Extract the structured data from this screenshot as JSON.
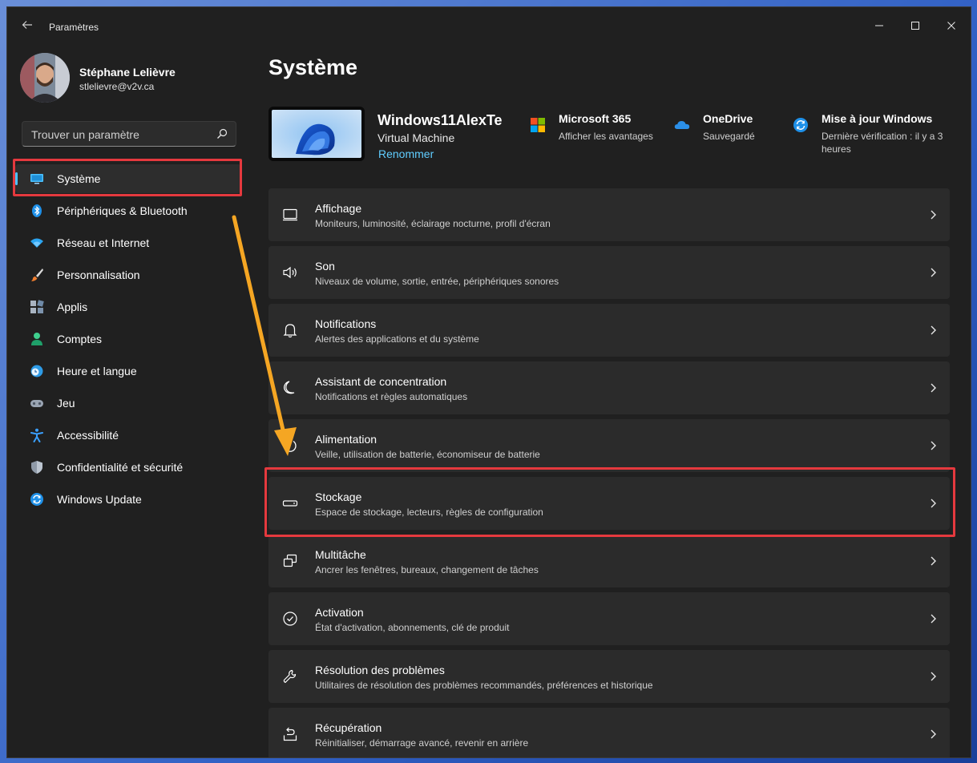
{
  "window": {
    "title": "Paramètres"
  },
  "profile": {
    "name": "Stéphane Lelièvre",
    "email": "stlelievre@v2v.ca"
  },
  "search": {
    "placeholder": "Trouver un paramètre"
  },
  "sidebar": {
    "items": [
      {
        "label": "Système",
        "icon": "monitor-icon",
        "active": true
      },
      {
        "label": "Périphériques & Bluetooth",
        "icon": "bluetooth-icon"
      },
      {
        "label": "Réseau et Internet",
        "icon": "wifi-icon"
      },
      {
        "label": "Personnalisation",
        "icon": "brush-icon"
      },
      {
        "label": "Applis",
        "icon": "apps-icon"
      },
      {
        "label": "Comptes",
        "icon": "person-icon"
      },
      {
        "label": "Heure et langue",
        "icon": "clock-globe-icon"
      },
      {
        "label": "Jeu",
        "icon": "gamepad-icon"
      },
      {
        "label": "Accessibilité",
        "icon": "accessibility-icon"
      },
      {
        "label": "Confidentialité et sécurité",
        "icon": "shield-icon"
      },
      {
        "label": "Windows Update",
        "icon": "update-icon"
      }
    ]
  },
  "main": {
    "title": "Système",
    "device": {
      "name": "Windows11AlexTe",
      "model": "Virtual Machine",
      "rename": "Renommer"
    },
    "info": [
      {
        "title": "Microsoft 365",
        "subtitle": "Afficher les avantages",
        "icon": "microsoft-logo-icon"
      },
      {
        "title": "OneDrive",
        "subtitle": "Sauvegardé",
        "icon": "cloud-icon"
      },
      {
        "title": "Mise à jour Windows",
        "subtitle": "Dernière vérification : il y a 3 heures",
        "icon": "update-icon"
      }
    ],
    "settings": [
      {
        "title": "Affichage",
        "subtitle": "Moniteurs, luminosité, éclairage nocturne, profil d'écran",
        "icon": "display-icon"
      },
      {
        "title": "Son",
        "subtitle": "Niveaux de volume, sortie, entrée, périphériques sonores",
        "icon": "speaker-icon"
      },
      {
        "title": "Notifications",
        "subtitle": "Alertes des applications et du système",
        "icon": "bell-icon"
      },
      {
        "title": "Assistant de concentration",
        "subtitle": "Notifications et règles automatiques",
        "icon": "moon-icon"
      },
      {
        "title": "Alimentation",
        "subtitle": "Veille, utilisation de batterie, économiseur de batterie",
        "icon": "power-icon"
      },
      {
        "title": "Stockage",
        "subtitle": "Espace de stockage, lecteurs, règles de configuration",
        "icon": "drive-icon"
      },
      {
        "title": "Multitâche",
        "subtitle": "Ancrer les fenêtres, bureaux, changement de tâches",
        "icon": "multitask-icon"
      },
      {
        "title": "Activation",
        "subtitle": "État d'activation, abonnements, clé de produit",
        "icon": "check-circle-icon"
      },
      {
        "title": "Résolution des problèmes",
        "subtitle": "Utilitaires de résolution des problèmes recommandés, préférences et historique",
        "icon": "wrench-icon"
      },
      {
        "title": "Récupération",
        "subtitle": "Réinitialiser, démarrage avancé, revenir en arrière",
        "icon": "recovery-icon"
      }
    ]
  },
  "colors": {
    "accent": "#4cc2ff",
    "link": "#60cdff",
    "highlight": "#e5393e",
    "arrow": "#f5a623",
    "window_bg": "#202020",
    "card_bg": "#2b2b2b"
  }
}
